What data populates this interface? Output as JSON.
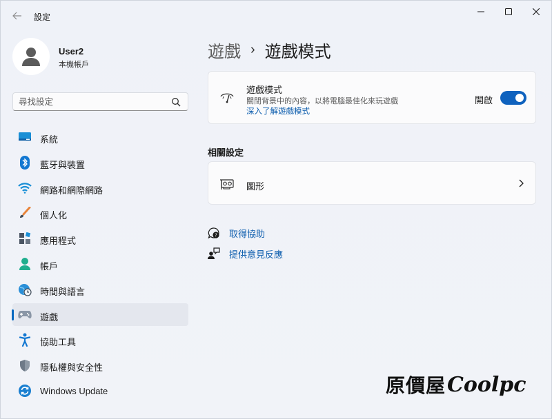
{
  "window": {
    "title": "設定"
  },
  "user": {
    "name": "User2",
    "account_type": "本機帳戶"
  },
  "search": {
    "placeholder": "尋找設定"
  },
  "sidebar": {
    "items": [
      {
        "label": "系統",
        "icon": "system-icon",
        "active": false
      },
      {
        "label": "藍牙與裝置",
        "icon": "bluetooth-icon",
        "active": false
      },
      {
        "label": "網路和網際網路",
        "icon": "wifi-icon",
        "active": false
      },
      {
        "label": "個人化",
        "icon": "brush-icon",
        "active": false
      },
      {
        "label": "應用程式",
        "icon": "apps-icon",
        "active": false
      },
      {
        "label": "帳戶",
        "icon": "account-icon",
        "active": false
      },
      {
        "label": "時間與語言",
        "icon": "globe-clock-icon",
        "active": false
      },
      {
        "label": "遊戲",
        "icon": "gamepad-icon",
        "active": true
      },
      {
        "label": "協助工具",
        "icon": "accessibility-icon",
        "active": false
      },
      {
        "label": "隱私權與安全性",
        "icon": "shield-icon",
        "active": false
      },
      {
        "label": "Windows Update",
        "icon": "update-icon",
        "active": false
      }
    ]
  },
  "breadcrumb": {
    "parent": "遊戲",
    "separator": "›",
    "current": "遊戲模式"
  },
  "game_mode": {
    "title": "遊戲模式",
    "description": "關閉背景中的內容，以將電腦最佳化來玩遊戲",
    "link": "深入了解遊戲模式",
    "toggle_label": "開啟",
    "toggle_on": true
  },
  "related": {
    "title": "相關設定",
    "graphics_label": "圖形"
  },
  "help": {
    "get_help": "取得協助",
    "feedback": "提供意見反應"
  },
  "watermark": {
    "cn": "原價屋",
    "en": "Coolpc"
  },
  "colors": {
    "accent": "#0f62be",
    "link": "#0b5cad"
  }
}
